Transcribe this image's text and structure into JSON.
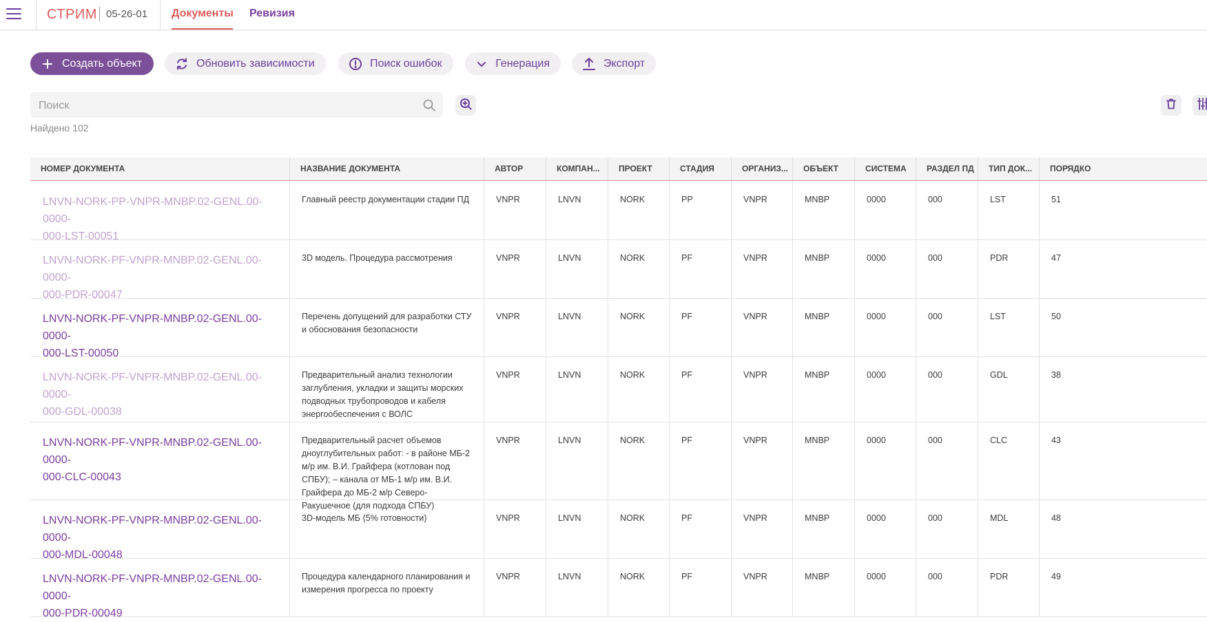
{
  "app": {
    "brand": "СТРИМ",
    "code": "05-26-01"
  },
  "tabs": [
    {
      "label": "Документы"
    },
    {
      "label": "Ревизия"
    }
  ],
  "toolbar": {
    "create_label": "Создать объект",
    "update_label": "Обновить зависимости",
    "errors_label": "Поиск ошибок",
    "generation_label": "Генерация",
    "export_label": "Экспорт"
  },
  "search": {
    "placeholder": "Поиск",
    "value": ""
  },
  "found": {
    "label": "Найдено",
    "count": "102"
  },
  "colors": {
    "accent": "#7a3f9e",
    "brand": "#e05a5a",
    "faded_link": "#c1a4cf"
  },
  "table": {
    "headers": [
      "НОМЕР ДОКУМЕНТА",
      "НАЗВАНИЕ ДОКУМЕНТА",
      "АВТОР",
      "КОМПАН...",
      "ПРОЕКТ",
      "СТАДИЯ",
      "ОРГАНИЗ...",
      "ОБЪЕКТ",
      "СИСТЕМА",
      "РАЗДЕЛ ПД",
      "ТИП ДОК...",
      "ПОРЯДКО"
    ],
    "rows": [
      {
        "number_line1": "LNVN-NORK-PP-VNPR-MNBP.02-GENL.00-0000-",
        "number_line2": "000-LST-00051",
        "visited": true,
        "name": "Главный реестр документации стадии ПД",
        "author": "VNPR",
        "company": "LNVN",
        "project": "NORK",
        "stage": "PP",
        "org": "VNPR",
        "object": "MNBP",
        "system": "0000",
        "section": "000",
        "type": "LST",
        "order": "51"
      },
      {
        "number_line1": "LNVN-NORK-PF-VNPR-MNBP.02-GENL.00-0000-",
        "number_line2": "000-PDR-00047",
        "visited": true,
        "name": "3D модель. Процедура рассмотрения",
        "author": "VNPR",
        "company": "LNVN",
        "project": "NORK",
        "stage": "PF",
        "org": "VNPR",
        "object": "MNBP",
        "system": "0000",
        "section": "000",
        "type": "PDR",
        "order": "47"
      },
      {
        "number_line1": "LNVN-NORK-PF-VNPR-MNBP.02-GENL.00-0000-",
        "number_line2": "000-LST-00050",
        "visited": false,
        "name": "Перечень допущений для разработки СТУ и обоснования безопасности",
        "author": "VNPR",
        "company": "LNVN",
        "project": "NORK",
        "stage": "PF",
        "org": "VNPR",
        "object": "MNBP",
        "system": "0000",
        "section": "000",
        "type": "LST",
        "order": "50"
      },
      {
        "number_line1": "LNVN-NORK-PF-VNPR-MNBP.02-GENL.00-0000-",
        "number_line2": "000-GDL-00038",
        "visited": true,
        "name": "Предварительный анализ технологии заглубления, укладки и защиты морских подводных трубопроводов и кабеля энергообеспечения с ВОЛС",
        "author": "VNPR",
        "company": "LNVN",
        "project": "NORK",
        "stage": "PF",
        "org": "VNPR",
        "object": "MNBP",
        "system": "0000",
        "section": "000",
        "type": "GDL",
        "order": "38"
      },
      {
        "number_line1": "LNVN-NORK-PF-VNPR-MNBP.02-GENL.00-0000-",
        "number_line2": "000-CLC-00043",
        "visited": false,
        "name": "Предварительный расчет объемов дноуглубительных работ: - в районе МБ-2 м/р им. В.И. Грайфера (котлован под СПБУ); – канала от МБ-1 м/р им. В.И. Грайфера до МБ-2 м/р Северо-Ракушечное (для подхода СПБУ)",
        "author": "VNPR",
        "company": "LNVN",
        "project": "NORK",
        "stage": "PF",
        "org": "VNPR",
        "object": "MNBP",
        "system": "0000",
        "section": "000",
        "type": "CLC",
        "order": "43"
      },
      {
        "number_line1": "LNVN-NORK-PF-VNPR-MNBP.02-GENL.00-0000-",
        "number_line2": "000-MDL-00048",
        "visited": false,
        "name": "3D-модель МБ (5% готовности)",
        "author": "VNPR",
        "company": "LNVN",
        "project": "NORK",
        "stage": "PF",
        "org": "VNPR",
        "object": "MNBP",
        "system": "0000",
        "section": "000",
        "type": "MDL",
        "order": "48"
      },
      {
        "number_line1": "LNVN-NORK-PF-VNPR-MNBP.02-GENL.00-0000-",
        "number_line2": "000-PDR-00049",
        "visited": false,
        "name": "Процедура календарного планирования и измерения прогресса по проекту",
        "author": "VNPR",
        "company": "LNVN",
        "project": "NORK",
        "stage": "PF",
        "org": "VNPR",
        "object": "MNBP",
        "system": "0000",
        "section": "000",
        "type": "PDR",
        "order": "49"
      }
    ]
  }
}
